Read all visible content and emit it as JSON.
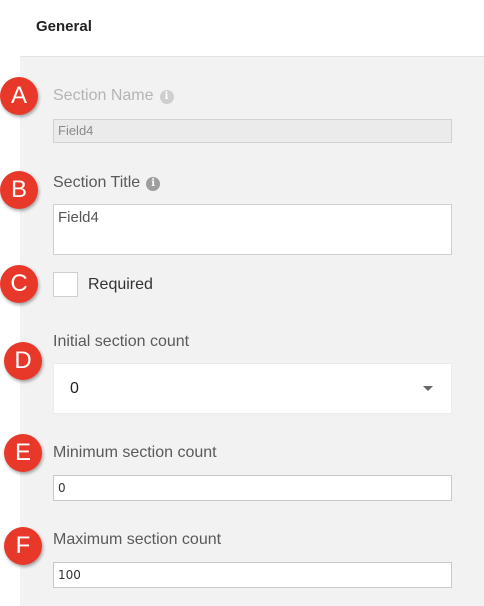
{
  "header": {
    "title": "General"
  },
  "markers": [
    "A",
    "B",
    "C",
    "D",
    "E",
    "F"
  ],
  "section_name": {
    "label": "Section Name",
    "value": "Field4"
  },
  "section_title": {
    "label": "Section Title",
    "value": "Field4"
  },
  "required": {
    "label": "Required",
    "checked": false
  },
  "initial_count": {
    "label": "Initial section count",
    "value": "0"
  },
  "min_count": {
    "label": "Minimum section count",
    "value": "0"
  },
  "max_count": {
    "label": "Maximum section count",
    "value": "100"
  },
  "icons": {
    "info": "info-icon"
  },
  "colors": {
    "marker": "#e8382a",
    "panel": "#f2f2f2"
  }
}
